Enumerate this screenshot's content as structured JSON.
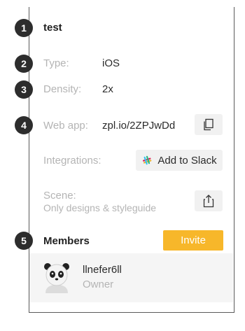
{
  "project": {
    "name": "test"
  },
  "badges": [
    "1",
    "2",
    "3",
    "4",
    "5"
  ],
  "type": {
    "label": "Type:",
    "value": "iOS"
  },
  "density": {
    "label": "Density:",
    "value": "2x"
  },
  "web_app": {
    "label": "Web app:",
    "value": "zpl.io/2ZPJwDd"
  },
  "integrations": {
    "label": "Integrations:",
    "button_label": "Add to Slack"
  },
  "scene": {
    "label": "Scene:",
    "value": "Only designs & styleguide"
  },
  "members": {
    "title": "Members",
    "invite_label": "Invite",
    "list": [
      {
        "name": "llnefer6ll",
        "role": "Owner"
      }
    ]
  },
  "colors": {
    "accent": "#f7b72a",
    "badge": "#2d2d2d",
    "muted_text": "#b4b4b4"
  },
  "icons": [
    "copy-icon",
    "slack-icon",
    "share-icon",
    "panda-avatar"
  ]
}
